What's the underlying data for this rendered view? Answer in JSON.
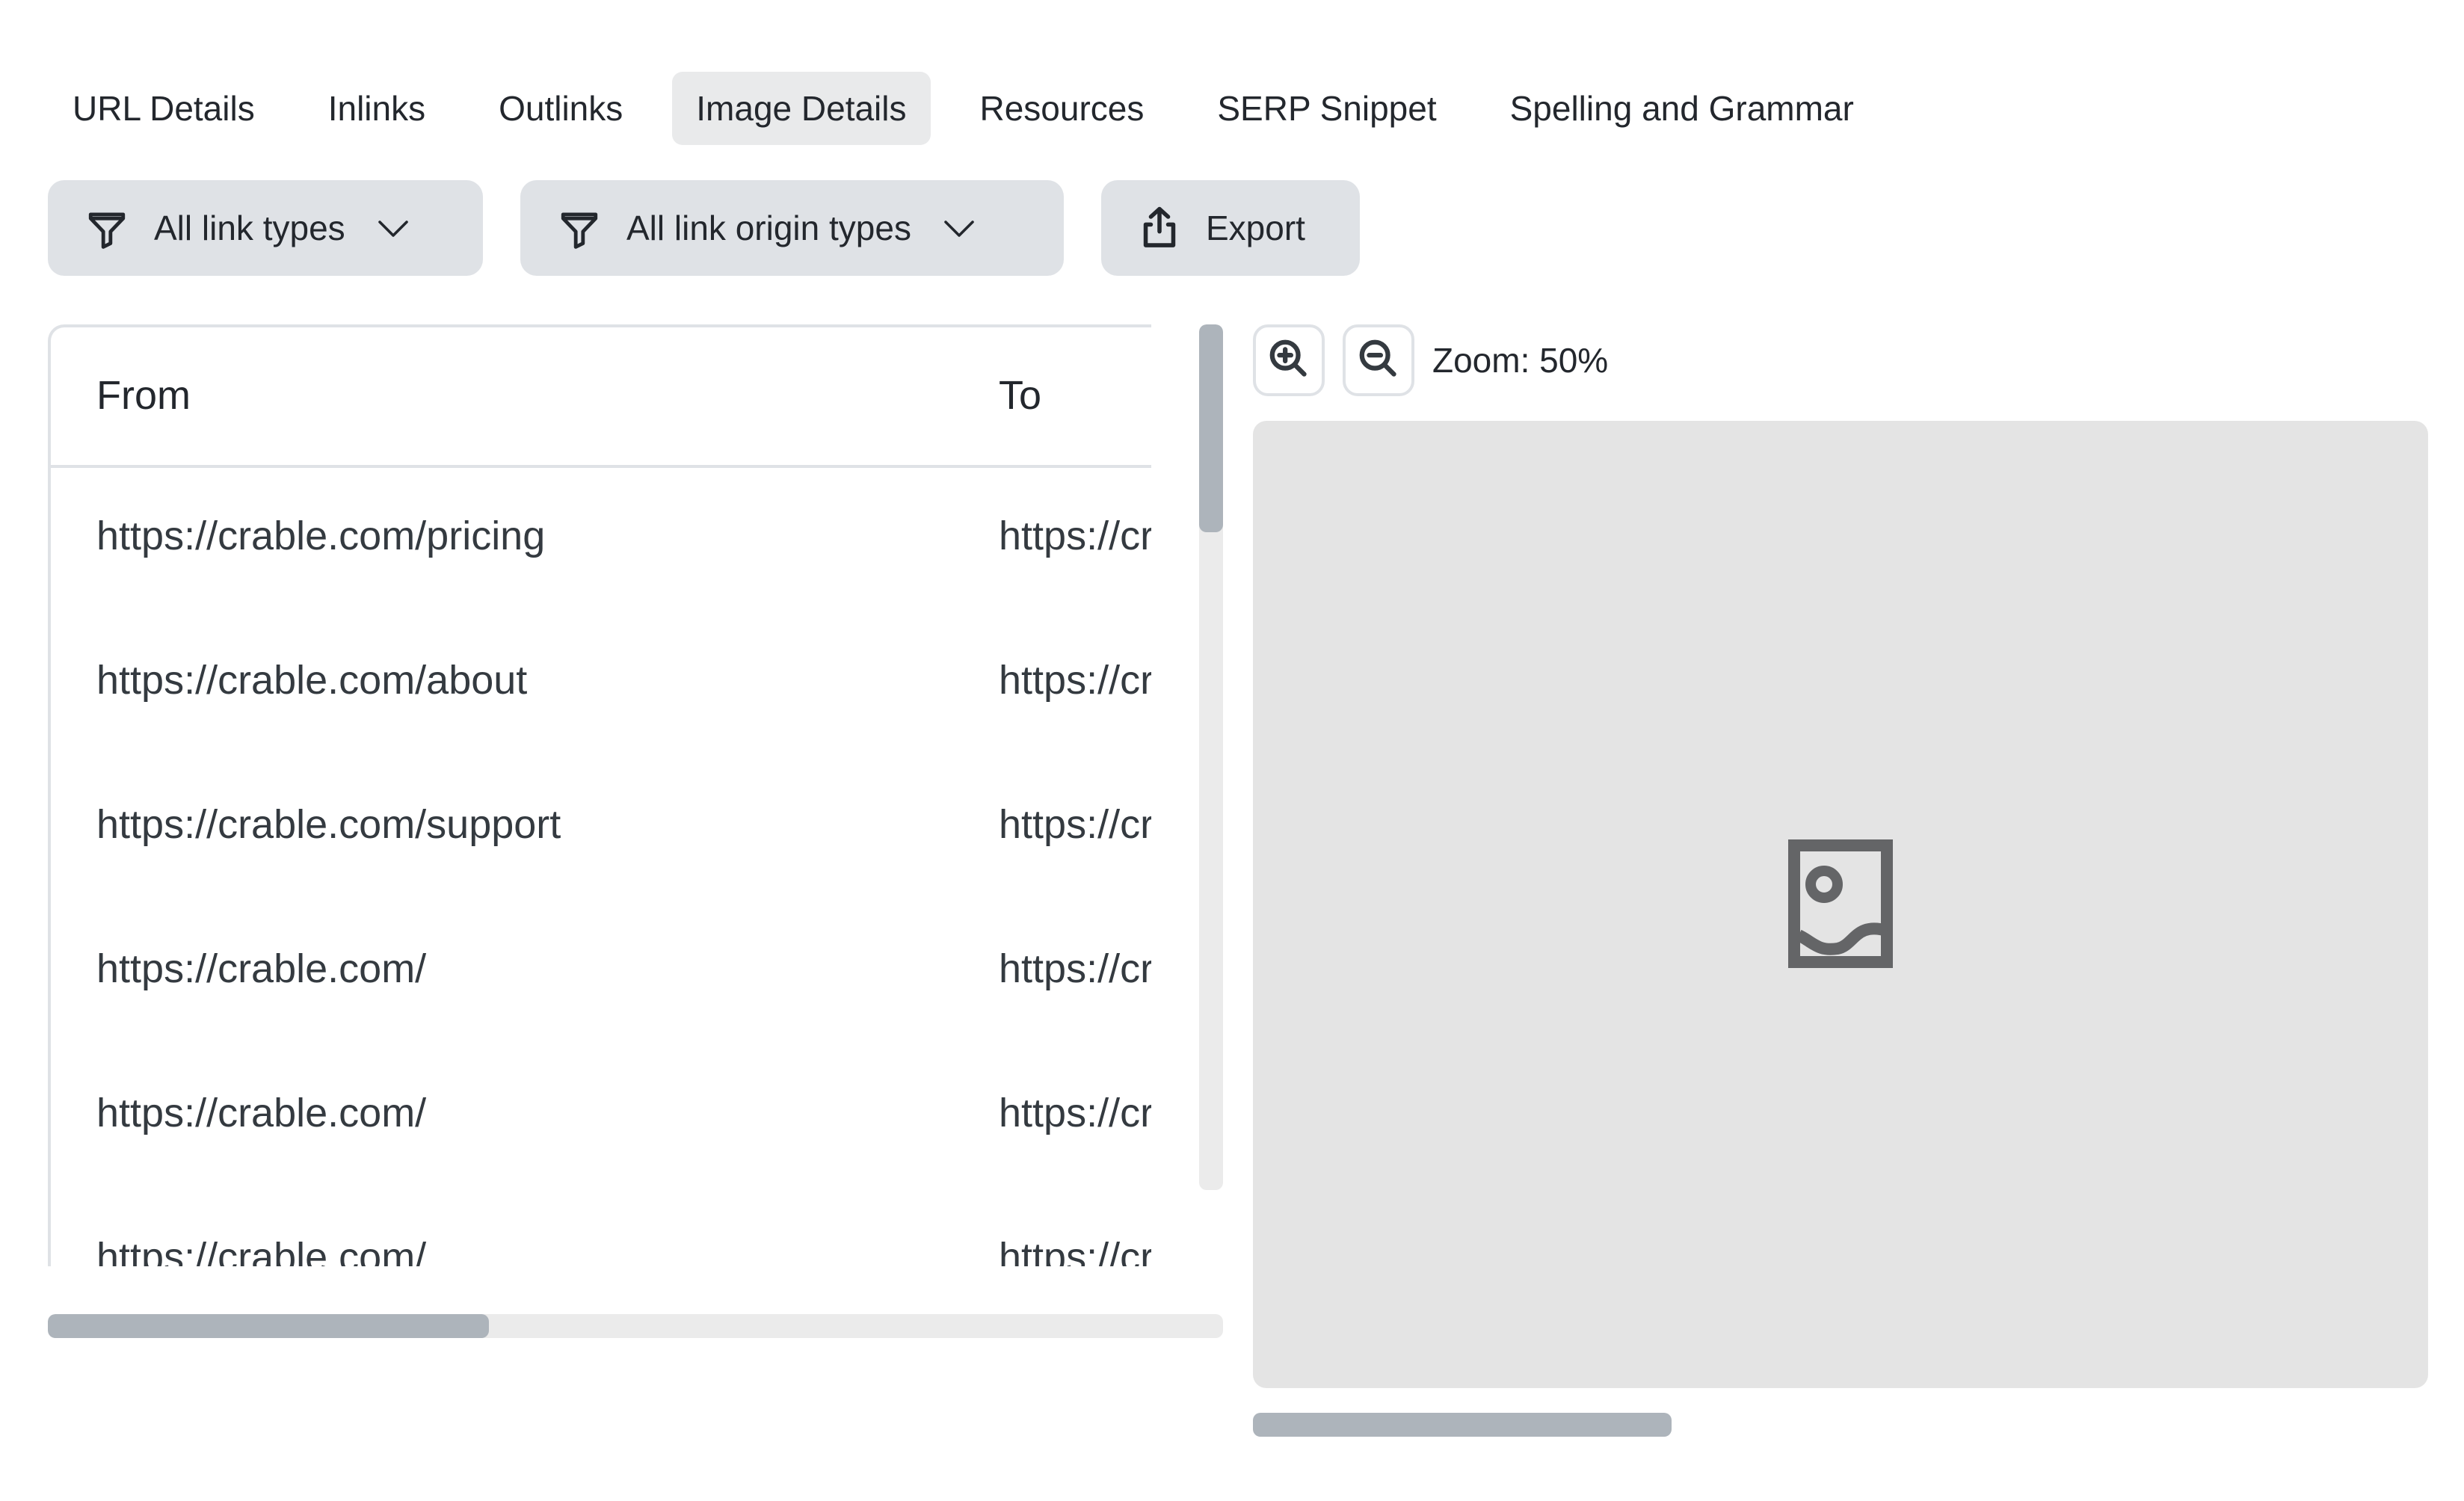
{
  "tabs": [
    {
      "label": "URL Details",
      "active": false
    },
    {
      "label": "Inlinks",
      "active": false
    },
    {
      "label": "Outlinks",
      "active": false
    },
    {
      "label": "Image Details",
      "active": true
    },
    {
      "label": "Resources",
      "active": false
    },
    {
      "label": "SERP Snippet",
      "active": false
    },
    {
      "label": "Spelling and Grammar",
      "active": false
    }
  ],
  "toolbar": {
    "link_types_filter": {
      "label": "All link types",
      "icon": "filter-icon",
      "chevron": "chevron-down-icon"
    },
    "link_origin_filter": {
      "label": "All link origin types",
      "icon": "filter-icon",
      "chevron": "chevron-down-icon"
    },
    "export": {
      "label": "Export",
      "icon": "share-export-icon"
    }
  },
  "table": {
    "columns": [
      "From",
      "To"
    ],
    "rows": [
      {
        "from": "https://crable.com/pricing",
        "to": "https://crable.com/"
      },
      {
        "from": "https://crable.com/about",
        "to": "https://crable.com/"
      },
      {
        "from": "https://crable.com/support",
        "to": "https://crable.com/"
      },
      {
        "from": "https://crable.com/",
        "to": "https://crable.com/"
      },
      {
        "from": "https://crable.com/",
        "to": "https://crable.com/"
      },
      {
        "from": "https://crable.com/",
        "to": "https://crable.com/"
      }
    ],
    "vertical_scroll": {
      "thumb_fraction": 0.24,
      "position": 0
    },
    "horizontal_scroll": {
      "thumb_fraction": 0.375,
      "position": 0
    }
  },
  "preview": {
    "zoom_in_icon": "zoom-in-icon",
    "zoom_out_icon": "zoom-out-icon",
    "zoom_label": "Zoom: 50%",
    "zoom_percent": 50,
    "placeholder_icon": "image-placeholder-icon",
    "horizontal_scroll": {
      "thumb_fraction": 0.356,
      "position": 0
    }
  },
  "colors": {
    "text": "#23272d",
    "button_bg": "#dfe2e6",
    "active_tab_bg": "#e9eaeb",
    "preview_bg": "#e4e4e4",
    "scroll_thumb": "#adb4bb",
    "scroll_track": "#ebebeb",
    "icon_gray": "#646567"
  }
}
